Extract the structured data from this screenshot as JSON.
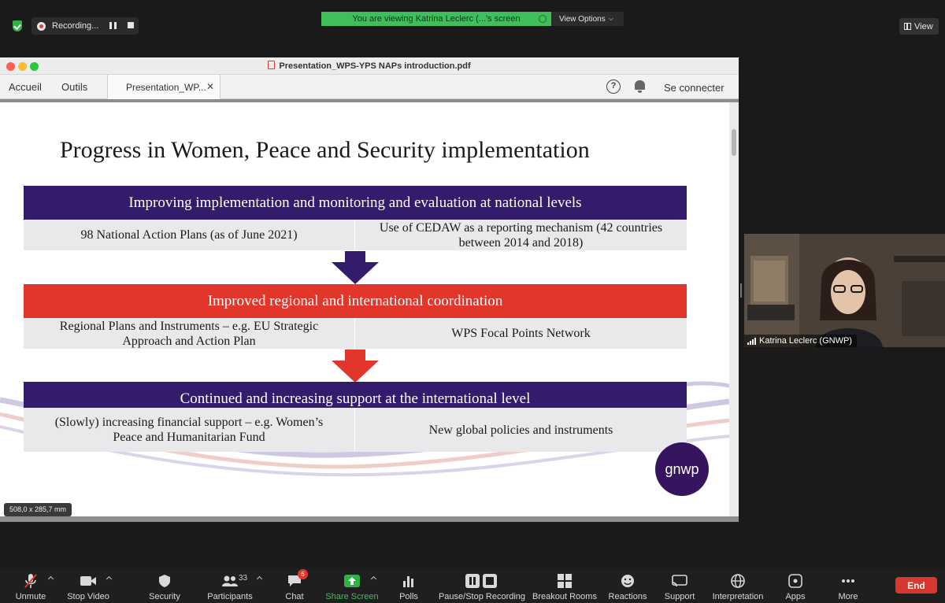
{
  "colors": {
    "zoom_green": "#3fbf5c",
    "slide_purple": "#341b6b",
    "slide_red": "#e2362d",
    "end_red": "#d6372e"
  },
  "top_bar": {
    "recording_label": "Recording...",
    "viewing_banner": "You are viewing Katrina Leclerc (...'s screen",
    "view_options_label": "View Options",
    "view_label": "View"
  },
  "pdf_window": {
    "title": "Presentation_WPS-YPS NAPs introduction.pdf",
    "nav": {
      "home": "Accueil",
      "tools": "Outils"
    },
    "tab_label": "Presentation_WP...",
    "help_symbol": "?",
    "sign_in": "Se connecter",
    "page_dimensions": "508,0 x 285,7 mm"
  },
  "slide": {
    "title": "Progress in Women, Peace and Security implementation",
    "sections": [
      {
        "heading": "Improving implementation and monitoring and evaluation at national levels",
        "left": "98 National Action Plans (as of June 2021)",
        "right_line1": "Use of CEDAW as a reporting mechanism (42 countries",
        "right_line2": "between 2014 and 2018)"
      },
      {
        "heading": "Improved regional and international coordination",
        "left_line1": "Regional Plans and Instruments – e.g. EU Strategic",
        "left_line2": "Approach and Action Plan",
        "right": "WPS Focal Points Network"
      },
      {
        "heading": "Continued and increasing support at the international level",
        "left_line1": "(Slowly) increasing financial support – e.g. Women’s",
        "left_line2": "Peace and Humanitarian Fund",
        "right": "New global policies and instruments"
      }
    ],
    "logo_text": "gnwp"
  },
  "participant": {
    "name": "Katrina Leclerc (GNWP)"
  },
  "toolbar": {
    "unmute": "Unmute",
    "stop_video": "Stop Video",
    "security": "Security",
    "participants": "Participants",
    "participants_count": "33",
    "chat": "Chat",
    "chat_badge": "6",
    "share_screen": "Share Screen",
    "polls": "Polls",
    "pause_stop_recording": "Pause/Stop Recording",
    "breakout_rooms": "Breakout Rooms",
    "reactions": "Reactions",
    "support": "Support",
    "interpretation": "Interpretation",
    "apps": "Apps",
    "more": "More",
    "end": "End"
  }
}
